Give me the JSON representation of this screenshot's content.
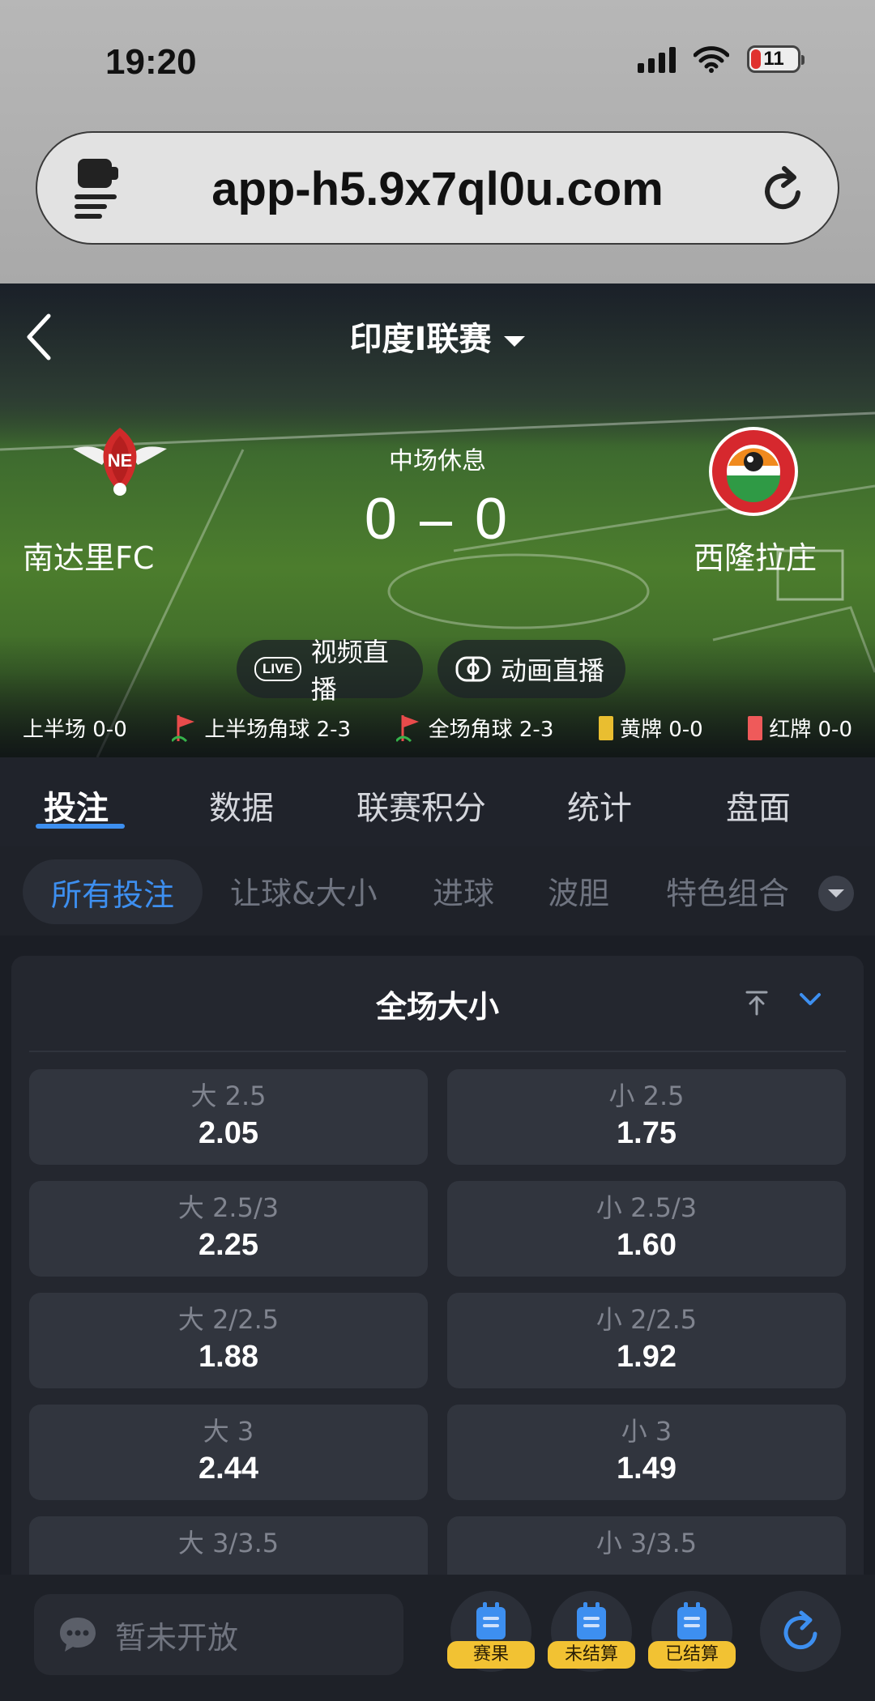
{
  "status_bar": {
    "time": "19:20",
    "battery": "11"
  },
  "browser": {
    "url": "app-h5.9x7ql0u.com"
  },
  "match": {
    "league": "印度I联赛",
    "status": "中场休息",
    "score": "0 – 0",
    "home_team": "南达里FC",
    "away_team": "西隆拉庄",
    "live_video_badge": "LIVE",
    "live_video_label": "视频直播",
    "animation_label": "动画直播",
    "stats": {
      "first_half": "上半场 0-0",
      "first_half_corners": "上半场角球 2-3",
      "full_corners": "全场角球 2-3",
      "yellow_cards": "黄牌 0-0",
      "red_cards": "红牌 0-0"
    }
  },
  "main_tabs": [
    "投注",
    "数据",
    "联赛积分",
    "统计",
    "盘面"
  ],
  "sub_tabs": [
    "所有投注",
    "让球&大小",
    "进球",
    "波胆",
    "特色组合"
  ],
  "market": {
    "title": "全场大小",
    "odds": [
      {
        "over_label": "大 2.5",
        "over_value": "2.05",
        "under_label": "小 2.5",
        "under_value": "1.75"
      },
      {
        "over_label": "大 2.5/3",
        "over_value": "2.25",
        "under_label": "小 2.5/3",
        "under_value": "1.60"
      },
      {
        "over_label": "大 2/2.5",
        "over_value": "1.88",
        "under_label": "小 2/2.5",
        "under_value": "1.92"
      },
      {
        "over_label": "大 3",
        "over_value": "2.44",
        "under_label": "小 3",
        "under_value": "1.49"
      },
      {
        "over_label": "大 3/3.5",
        "over_value": "",
        "under_label": "小 3/3.5",
        "under_value": ""
      }
    ]
  },
  "bottom_bar": {
    "chat_placeholder": "暂未开放",
    "results_label": "赛果",
    "unsettled_label": "未结算",
    "settled_label": "已结算"
  },
  "colors": {
    "accent": "#3d8ff0",
    "card_yellow": "#e9be30",
    "card_red": "#ef5a5a",
    "tag_yellow": "#f2c233",
    "dark_bg": "#1b1e25"
  }
}
